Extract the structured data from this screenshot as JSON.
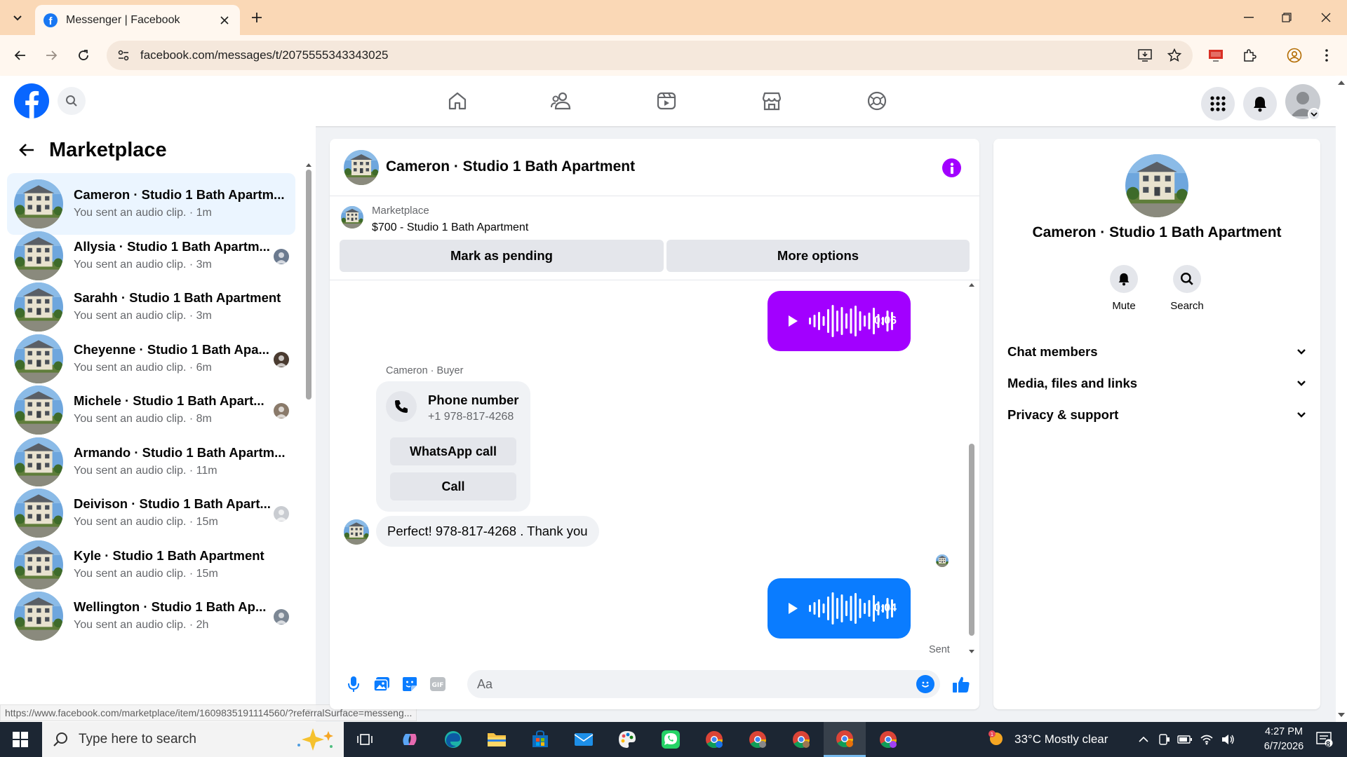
{
  "browser": {
    "tab_title": "Messenger | Facebook",
    "url": "facebook.com/messages/t/2075555343343025",
    "status_url": "https://www.facebook.com/marketplace/item/1609835191114560/?referralSurface=messeng..."
  },
  "sidebar": {
    "title": "Marketplace",
    "conversations": [
      {
        "name": "Cameron · Studio 1 Bath Apartm...",
        "preview": "You sent an audio clip. · 1m",
        "active": true
      },
      {
        "name": "Allysia · Studio 1 Bath Apartm...",
        "preview": "You sent an audio clip. · 3m"
      },
      {
        "name": "Sarahh · Studio 1 Bath Apartment",
        "preview": "You sent an audio clip. · 3m"
      },
      {
        "name": "Cheyenne · Studio 1 Bath Apa...",
        "preview": "You sent an audio clip. · 6m"
      },
      {
        "name": "Michele · Studio 1 Bath Apart...",
        "preview": "You sent an audio clip. · 8m"
      },
      {
        "name": "Armando · Studio 1 Bath Apartm...",
        "preview": "You sent an audio clip. · 11m"
      },
      {
        "name": "Deivison · Studio 1 Bath Apart...",
        "preview": "You sent an audio clip. · 15m"
      },
      {
        "name": "Kyle · Studio 1 Bath Apartment",
        "preview": "You sent an audio clip. · 15m"
      },
      {
        "name": "Wellington · Studio 1 Bath Ap...",
        "preview": "You sent an audio clip. · 2h"
      }
    ]
  },
  "chat": {
    "title": "Cameron · Studio 1 Bath Apartment",
    "marketplace_label": "Marketplace",
    "listing": "$700 - Studio 1 Bath Apartment",
    "mark_pending": "Mark as pending",
    "more_options": "More options",
    "audio1_duration": "0:06",
    "sender_label": "Cameron · Buyer",
    "phone_card_title": "Phone number",
    "phone_card_number": "+1 978-817-4268",
    "whatsapp_call": "WhatsApp call",
    "call": "Call",
    "incoming_message": "Perfect! 978-817-4268 . Thank you",
    "audio2_duration": "0:04",
    "sent_status": "Sent",
    "composer_placeholder": "Aa",
    "colors": {
      "audio1": "#a200ff",
      "audio2": "#0a7cff"
    }
  },
  "details": {
    "name": "Cameron · Studio 1 Bath Apartment",
    "mute": "Mute",
    "search": "Search",
    "sections": [
      "Chat members",
      "Media, files and links",
      "Privacy & support"
    ]
  },
  "taskbar": {
    "search_placeholder": "Type here to search",
    "weather": "33°C  Mostly clear",
    "time": "4:27 PM",
    "date": "6/7/2026",
    "notification_count": "8"
  }
}
